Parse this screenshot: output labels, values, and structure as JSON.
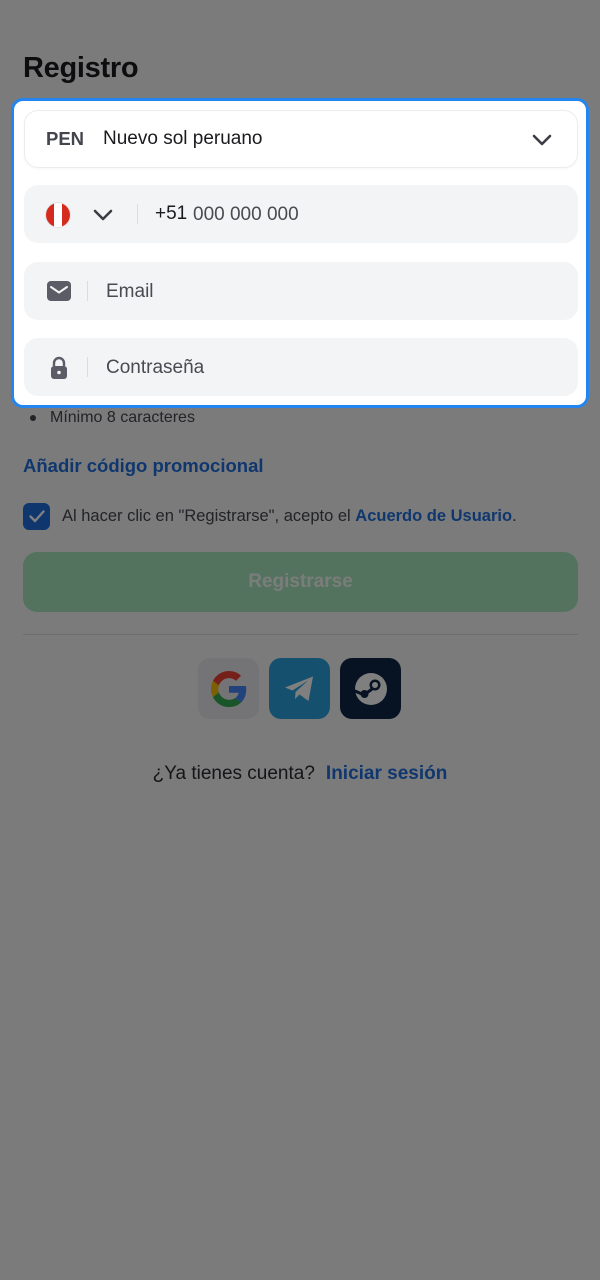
{
  "page": {
    "title": "Registro"
  },
  "currency": {
    "code": "PEN",
    "name": "Nuevo sol peruano"
  },
  "phone": {
    "country": "PE",
    "dial_code": "+51",
    "placeholder": "000 000 000"
  },
  "email": {
    "placeholder": "Email"
  },
  "password": {
    "placeholder": "Contraseña",
    "hint": "Mínimo 8 caracteres"
  },
  "promo": {
    "label": "Añadir código promocional"
  },
  "terms": {
    "checked": true,
    "text": "Al hacer clic en \"Registrarse\", acepto el",
    "link": "Acuerdo de Usuario",
    "suffix": "."
  },
  "register": {
    "label": "Registrarse"
  },
  "social": {
    "providers": [
      "google-icon",
      "telegram-icon",
      "steam-icon"
    ]
  },
  "login": {
    "question": "¿Ya tienes cuenta?",
    "link": "Iniciar sesión"
  },
  "colors": {
    "accent": "#1f6fdd",
    "focus_border": "#2385ef",
    "register_button": "#a8e6be",
    "overlay": "rgba(0,0,0,0.5)"
  }
}
